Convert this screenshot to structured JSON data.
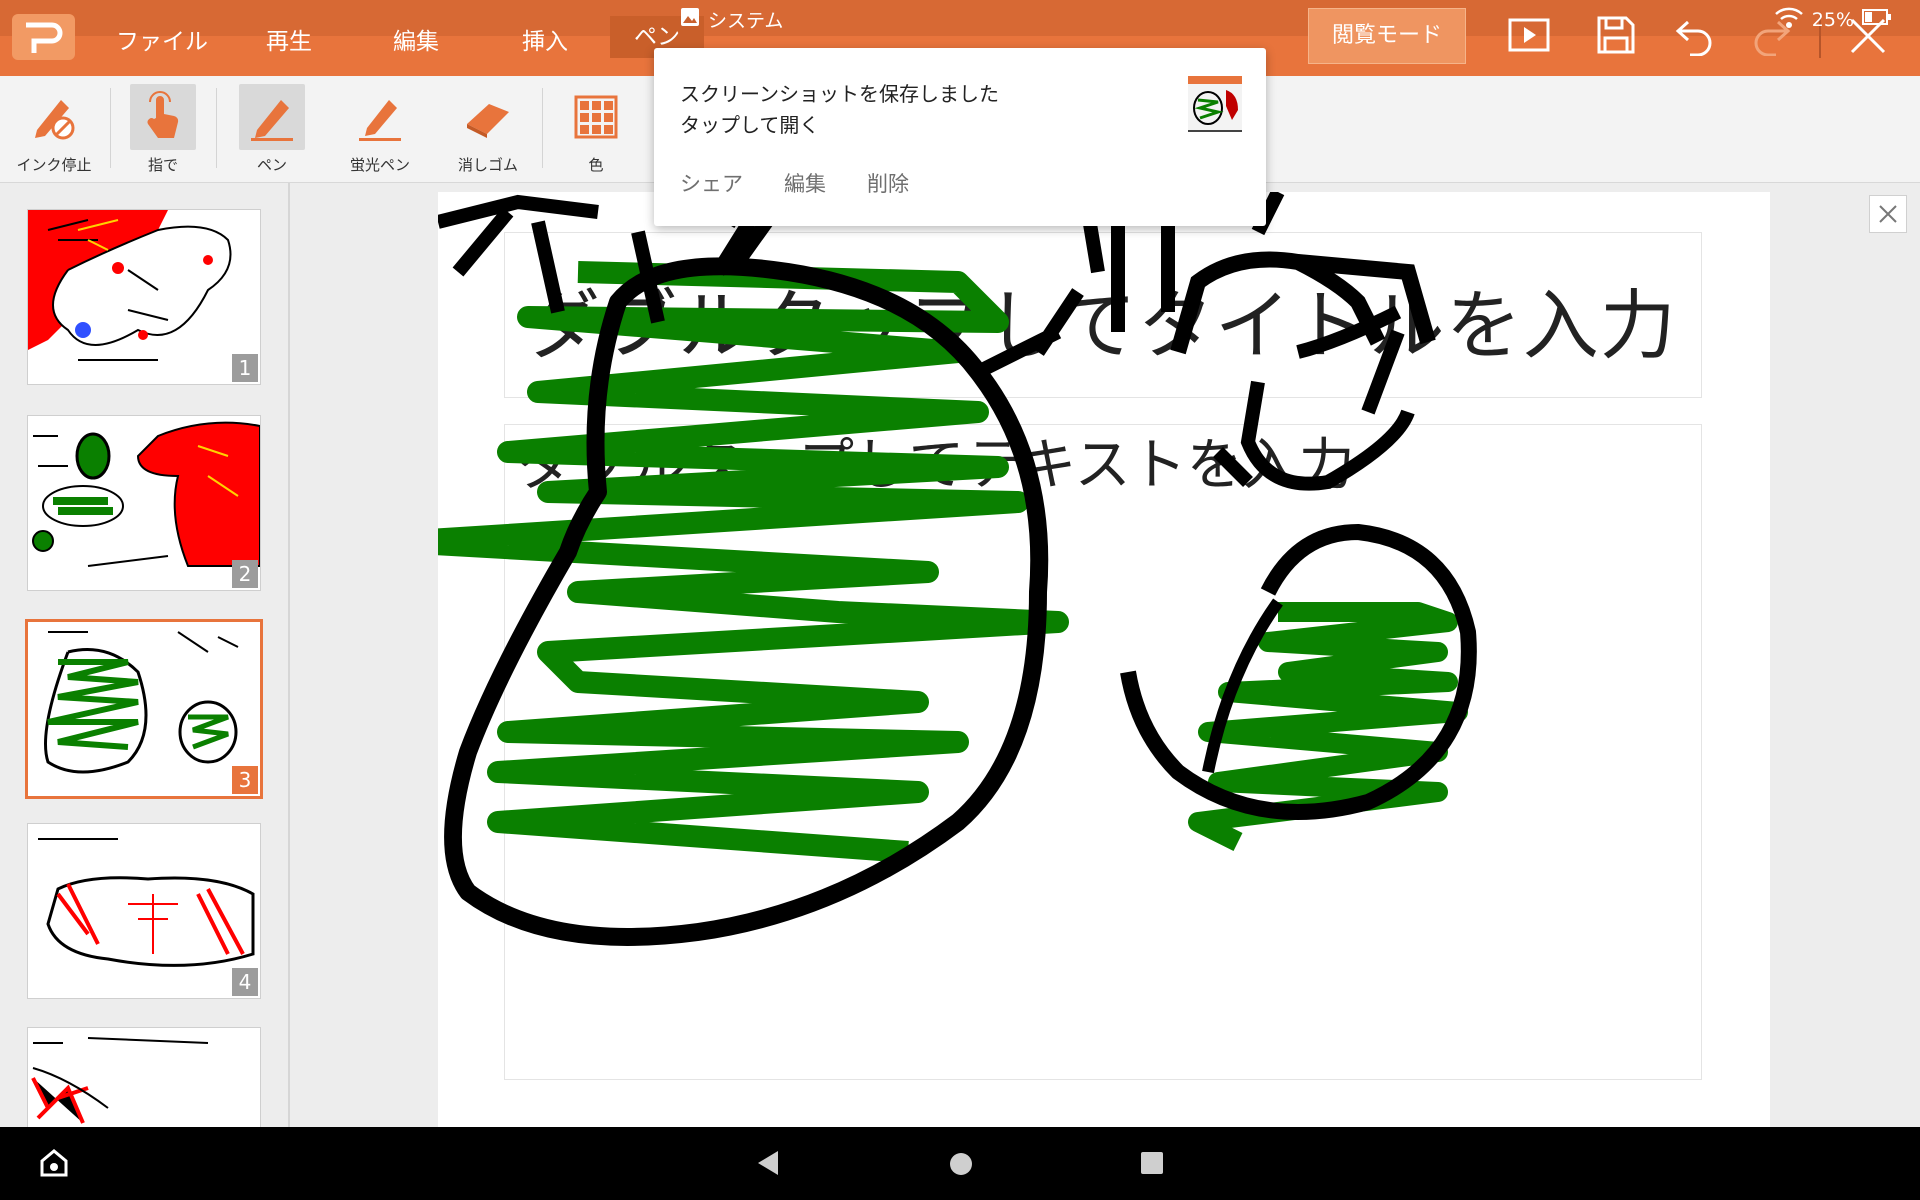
{
  "menu": {
    "file": "ファイル",
    "play": "再生",
    "edit": "編集",
    "insert": "挿入",
    "pen": "ペン",
    "read_mode": "閲覧モード"
  },
  "status": {
    "battery": "25%"
  },
  "ribbon": {
    "ink_stop": "インク停止",
    "finger": "指で",
    "pen": "ペン",
    "highlighter": "蛍光ペン",
    "eraser": "消しゴム",
    "color": "色"
  },
  "slides": {
    "numbers": [
      "1",
      "2",
      "3",
      "4"
    ],
    "selected": 3
  },
  "slide": {
    "title_placeholder": "ダブルタップしてタイトルを入力",
    "body_placeholder": "ダブルタップしてテキストを入力"
  },
  "notification": {
    "app": "システム",
    "line1": "スクリーンショットを保存しました",
    "line2": "タップして開く",
    "share": "シェア",
    "edit": "編集",
    "delete": "削除"
  },
  "colors": {
    "accent": "#e8743c",
    "ink_black": "#000000",
    "ink_green": "#0a8000",
    "ink_red": "#ff0000"
  }
}
